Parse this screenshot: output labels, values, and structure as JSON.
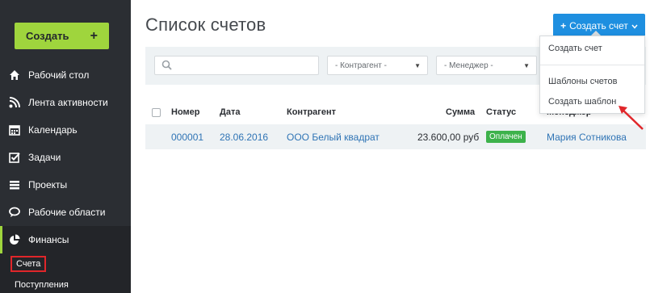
{
  "sidebar": {
    "create_label": "Создать",
    "create_plus": "+",
    "items": [
      {
        "label": "Рабочий стол",
        "icon": "home-icon"
      },
      {
        "label": "Лента активности",
        "icon": "rss-icon"
      },
      {
        "label": "Календарь",
        "icon": "calendar-icon"
      },
      {
        "label": "Задачи",
        "icon": "checkbox-icon"
      },
      {
        "label": "Проекты",
        "icon": "list-icon"
      },
      {
        "label": "Рабочие области",
        "icon": "chat-icon"
      },
      {
        "label": "Финансы",
        "icon": "pie-chart-icon"
      }
    ],
    "sub_items": [
      {
        "label": "Счета"
      },
      {
        "label": "Поступления"
      }
    ],
    "accent": "#9fd53d"
  },
  "main": {
    "title": "Список счетов",
    "create_button_label": "Создать счет",
    "create_button_plus": "+",
    "filters": {
      "search_placeholder": "",
      "contractor": "- Контрагент -",
      "manager": "- Менеджер -"
    },
    "table": {
      "headers": [
        "Номер",
        "Дата",
        "Контрагент",
        "Сумма",
        "Статус",
        "Менеджер"
      ],
      "rows": [
        {
          "number": "000001",
          "date": "28.06.2016",
          "contractor": "ООО Белый квадрат",
          "sum": "23.600,00 руб",
          "status": "Оплачен",
          "manager": "Мария Сотникова"
        }
      ]
    }
  },
  "dropdown": {
    "items": [
      "Создать счет",
      "Шаблоны счетов",
      "Создать шаблон"
    ]
  },
  "colors": {
    "sidebar_bg": "#2b2e33",
    "primary_button": "#1e8fe0",
    "status_paid": "#3db24b",
    "highlight_red": "#e0262a"
  }
}
